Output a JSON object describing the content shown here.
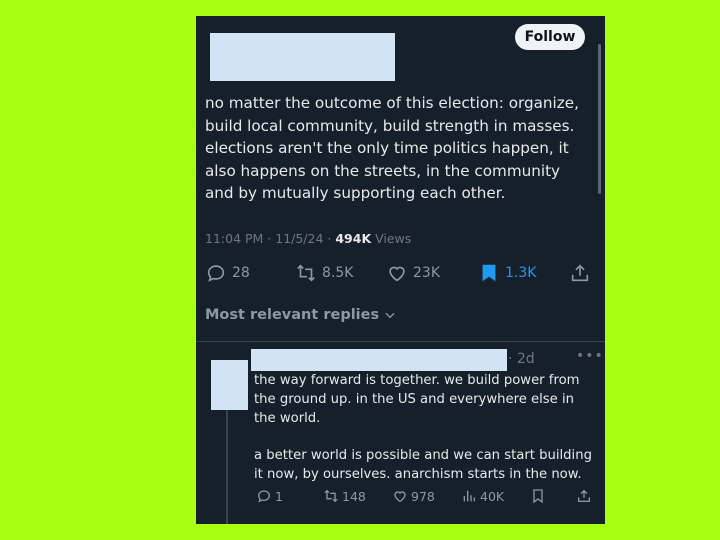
{
  "colors": {
    "background": "#a8ff12",
    "panel": "#15202b",
    "accent": "#1d9bf0",
    "muted": "#71767b"
  },
  "tweet": {
    "follow_label": "Follow",
    "text": "no matter the outcome of this election: organize, build local community, build strength in masses. elections aren't the only time politics happen, it also happens on the streets, in the community and by mutually supporting each other.",
    "timestamp": "11:04 PM · 11/5/24 · ",
    "views_count": "494K",
    "views_label": " Views",
    "actions": {
      "replies": "28",
      "reposts": "8.5K",
      "likes": "23K",
      "bookmarks": "1.3K"
    },
    "icons": [
      "reply-icon",
      "repost-icon",
      "like-icon",
      "bookmark-icon",
      "share-icon"
    ]
  },
  "replies_filter": {
    "label": "Most relevant replies"
  },
  "reply": {
    "time": "· 2d",
    "more": "•••",
    "paragraphs": [
      "the way forward is together. we build power from the ground up. in the US and everywhere else in the world.",
      "a better world is possible and we can start building it now, by ourselves. anarchism starts in the now."
    ],
    "actions": {
      "replies": "1",
      "reposts": "148",
      "likes": "978",
      "views": "40K"
    }
  }
}
